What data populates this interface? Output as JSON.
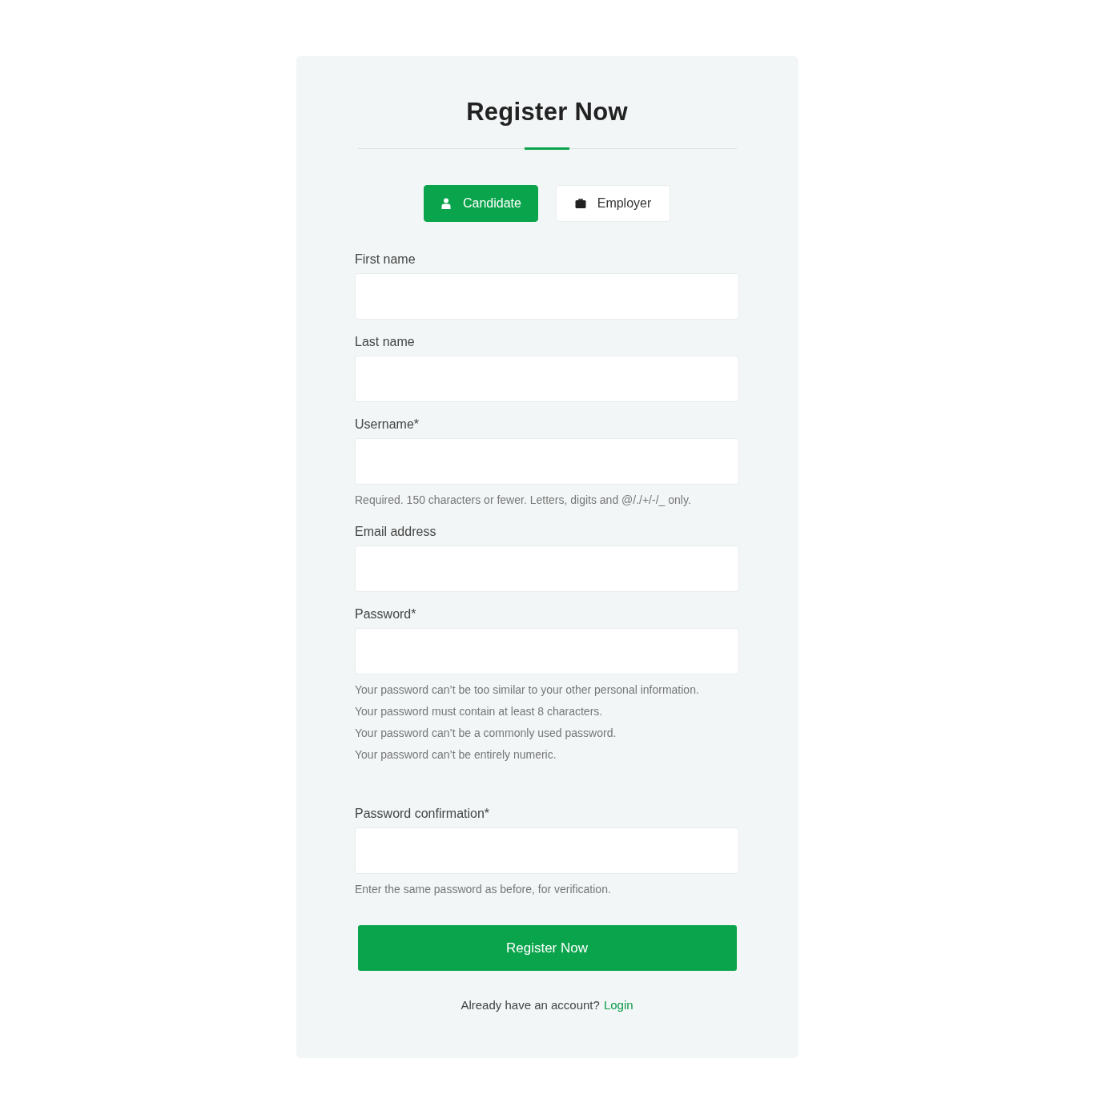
{
  "title": "Register Now",
  "tabs": [
    {
      "label": "Candidate",
      "kind": "person",
      "selected": true
    },
    {
      "label": "Employer",
      "kind": "briefcase",
      "selected": false
    }
  ],
  "fields": [
    {
      "label": "First name"
    },
    {
      "label": "Last name"
    },
    {
      "label": "Username*",
      "help": [
        "Required. 150 characters or fewer. Letters, digits and @/./+/-/_ only."
      ]
    },
    {
      "label": "Email address"
    },
    {
      "label": "Password*",
      "help": [
        "Your password can’t be too similar to your other personal information.",
        "Your password must contain at least 8 characters.",
        "Your password can’t be a commonly used password.",
        "Your password can’t be entirely numeric."
      ]
    },
    {
      "label": "Password confirmation*",
      "help": [
        "Enter the same password as before, for verification."
      ]
    }
  ],
  "submit": "Register Now",
  "footer": {
    "text": "Already have an account?",
    "link": "Login"
  }
}
